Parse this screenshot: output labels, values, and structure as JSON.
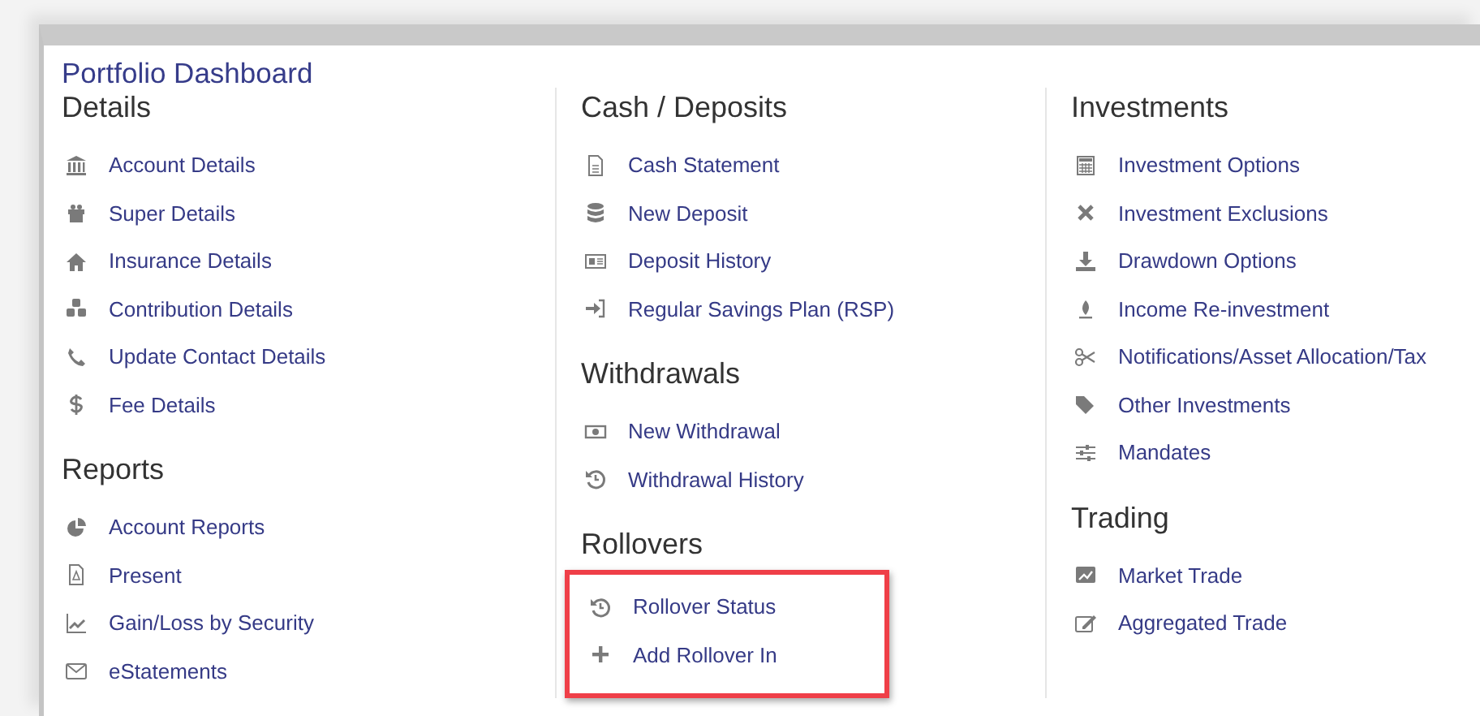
{
  "title": "Portfolio Dashboard",
  "columns": [
    {
      "sections": [
        {
          "heading": "Details",
          "highlighted": false,
          "items": [
            {
              "label": "Account Details"
            },
            {
              "label": "Super Details"
            },
            {
              "label": "Insurance Details"
            },
            {
              "label": "Contribution Details"
            },
            {
              "label": "Update Contact Details"
            },
            {
              "label": "Fee Details"
            }
          ]
        },
        {
          "heading": "Reports",
          "highlighted": false,
          "items": [
            {
              "label": "Account Reports"
            },
            {
              "label": "Present"
            },
            {
              "label": "Gain/Loss by Security"
            },
            {
              "label": "eStatements"
            }
          ]
        }
      ]
    },
    {
      "sections": [
        {
          "heading": "Cash / Deposits",
          "highlighted": false,
          "items": [
            {
              "label": "Cash Statement"
            },
            {
              "label": "New Deposit"
            },
            {
              "label": "Deposit History"
            },
            {
              "label": "Regular Savings Plan (RSP)"
            }
          ]
        },
        {
          "heading": "Withdrawals",
          "highlighted": false,
          "items": [
            {
              "label": "New Withdrawal"
            },
            {
              "label": "Withdrawal History"
            }
          ]
        },
        {
          "heading": "Rollovers",
          "highlighted": true,
          "items": [
            {
              "label": "Rollover Status"
            },
            {
              "label": "Add Rollover In"
            }
          ]
        }
      ]
    },
    {
      "sections": [
        {
          "heading": "Investments",
          "highlighted": false,
          "items": [
            {
              "label": "Investment Options"
            },
            {
              "label": "Investment Exclusions"
            },
            {
              "label": "Drawdown Options"
            },
            {
              "label": "Income Re-investment"
            },
            {
              "label": "Notifications/Asset Allocation/Tax"
            },
            {
              "label": "Other Investments"
            },
            {
              "label": "Mandates"
            }
          ]
        },
        {
          "heading": "Trading",
          "highlighted": false,
          "items": [
            {
              "label": "Market Trade"
            },
            {
              "label": "Aggregated Trade"
            }
          ]
        }
      ]
    }
  ]
}
